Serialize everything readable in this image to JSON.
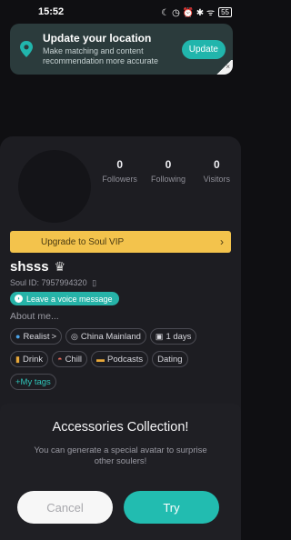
{
  "status_bar": {
    "time": "15:52",
    "icons_text": "☾ ◷ ⏰ ✱ ᯤ",
    "battery": "55"
  },
  "location_banner": {
    "title": "Update your location",
    "subtitle": "Make matching and content recommendation more accurate",
    "button": "Update",
    "close": "×",
    "icon": "location-pin-icon"
  },
  "stats": [
    {
      "value": "0",
      "label": "Followers"
    },
    {
      "value": "0",
      "label": "Following"
    },
    {
      "value": "0",
      "label": "Visitors"
    }
  ],
  "vip": {
    "label": "Upgrade to Soul VIP",
    "arrow": "›"
  },
  "profile": {
    "username": "shsss",
    "crown": "♛",
    "soul_id": "Soul ID: 7957994320",
    "copy": "▯",
    "voice_button": "Leave a voice message",
    "about_label": "About me..."
  },
  "tags": [
    [
      {
        "icon": "●",
        "label": "Realist",
        "suffix": ">"
      },
      {
        "icon": "◎",
        "label": "China Mainland"
      },
      {
        "icon": "▣",
        "label": "1 days"
      }
    ],
    [
      {
        "icon": "▮",
        "label": "Drink"
      },
      {
        "icon": "◓",
        "label": "Chill"
      },
      {
        "icon": "▬",
        "label": "Podcasts"
      },
      {
        "icon": "",
        "label": "Dating"
      }
    ],
    [
      {
        "icon": "",
        "label": "+My tags"
      }
    ]
  ],
  "modal": {
    "title": "Accessories Collection!",
    "description": "You can generate a special avatar to surprise other soulers!",
    "cancel": "Cancel",
    "try": "Try"
  },
  "colors": {
    "accent": "#22bcb0",
    "vip": "#f3c34c",
    "background": "#0f0f12"
  }
}
